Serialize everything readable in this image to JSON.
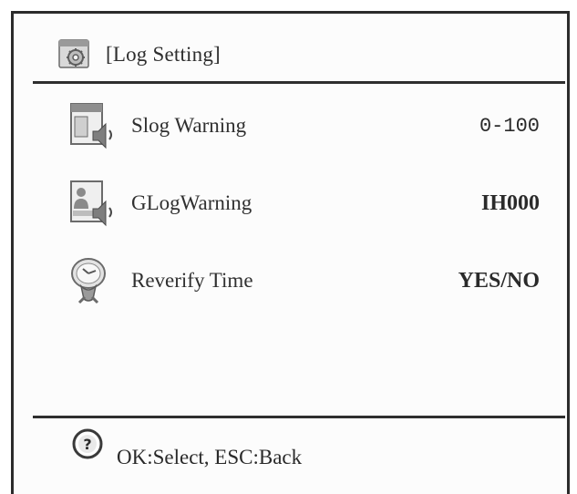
{
  "header": {
    "icon": "log-setting-icon",
    "title": "[Log Setting]"
  },
  "menu": {
    "items": [
      {
        "icon": "slog-warning-icon",
        "label": "Slog Warning",
        "value": "0-100"
      },
      {
        "icon": "glog-warning-icon",
        "label": "GLogWarning",
        "value": "IH000"
      },
      {
        "icon": "reverify-time-icon",
        "label": "Reverify Time",
        "value": "YES/NO"
      }
    ]
  },
  "footer": {
    "icon": "help-icon",
    "hint": "OK:Select, ESC:Back"
  }
}
